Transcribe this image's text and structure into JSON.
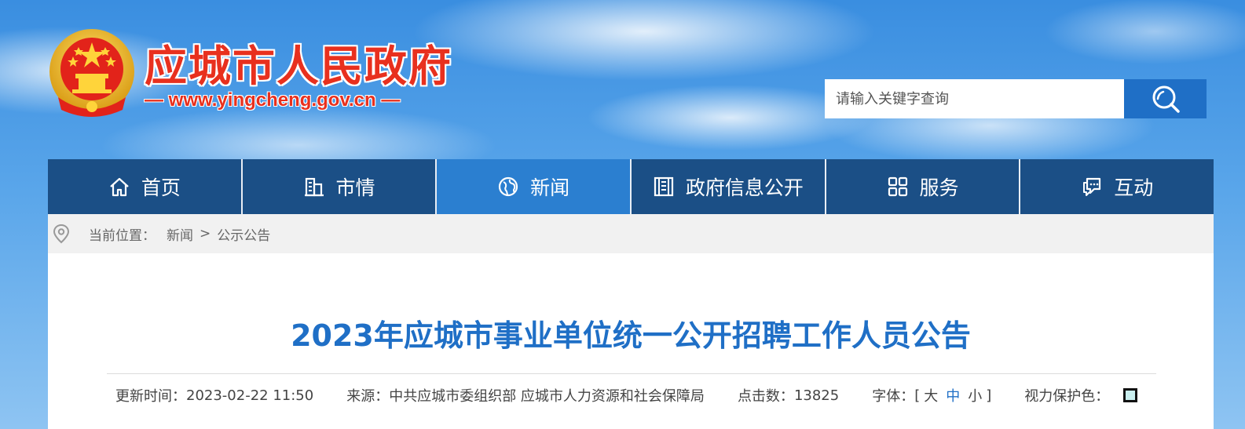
{
  "header": {
    "site_title": "应城市人民政府",
    "site_url": "— www.yingcheng.gov.cn —",
    "search": {
      "placeholder": "请输入关键字查询",
      "button_icon": "search-icon"
    }
  },
  "nav": {
    "items": [
      {
        "label": "首页",
        "icon": "home-icon"
      },
      {
        "label": "市情",
        "icon": "building-icon"
      },
      {
        "label": "新闻",
        "icon": "globe-icon",
        "active": true
      },
      {
        "label": "政府信息公开",
        "icon": "government-building-icon"
      },
      {
        "label": "服务",
        "icon": "grid-icon"
      },
      {
        "label": "互动",
        "icon": "chat-icon"
      }
    ]
  },
  "breadcrumb": {
    "prefix": "当前位置：",
    "items": [
      "新闻",
      "公示公告"
    ],
    "separator": ">"
  },
  "article": {
    "title": "2023年应城市事业单位统一公开招聘工作人员公告",
    "meta": {
      "updated_label": "更新时间：",
      "updated_value": "2023-02-22 11:50",
      "source_label": "来源：",
      "source_value": "中共应城市委组织部 应城市人力资源和社会保障局",
      "clicks_label": "点击数：",
      "clicks_value": "13825",
      "font_label": "字体：",
      "font_open": "[",
      "font_large": "大",
      "font_medium": "中",
      "font_small": "小",
      "font_close": "]",
      "eye_label": "视力保护色："
    }
  },
  "colors": {
    "title_red": "#e8301e",
    "nav_bg": "#1b4f86",
    "nav_active": "#2b7fd0",
    "accent_blue": "#1f6fc6"
  }
}
